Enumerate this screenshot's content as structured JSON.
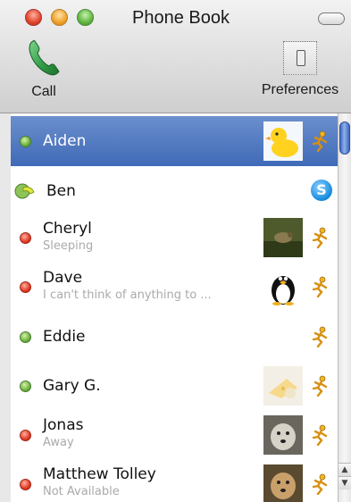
{
  "window": {
    "title": "Phone Book"
  },
  "toolbar": {
    "call_label": "Call",
    "preferences_label": "Preferences"
  },
  "contacts": [
    {
      "name": "Aiden",
      "status": "",
      "presence": "available",
      "service": "aim",
      "avatar": "rubber-duck",
      "selected": true
    },
    {
      "name": "Ben",
      "status": "",
      "presence": "available",
      "service": "skype",
      "avatar": "",
      "selected": false
    },
    {
      "name": "Cheryl",
      "status": "Sleeping",
      "presence": "away",
      "service": "aim",
      "avatar": "bird-photo",
      "selected": false
    },
    {
      "name": "Dave",
      "status": "I can't think of anything to ...",
      "presence": "away",
      "service": "aim",
      "avatar": "penguin",
      "selected": false
    },
    {
      "name": "Eddie",
      "status": "",
      "presence": "available",
      "service": "aim",
      "avatar": "",
      "selected": false
    },
    {
      "name": "Gary G.",
      "status": "",
      "presence": "available",
      "service": "aim",
      "avatar": "cheese",
      "selected": false
    },
    {
      "name": "Jonas",
      "status": "Away",
      "presence": "away",
      "service": "aim",
      "avatar": "dog-gray",
      "selected": false
    },
    {
      "name": "Matthew Tolley",
      "status": "Not Available",
      "presence": "away",
      "service": "aim",
      "avatar": "dog-golden",
      "selected": false
    }
  ],
  "colors": {
    "selection": "#4a74bd",
    "available": "#6fb33f",
    "away": "#e23a25",
    "aim_running_man": "#e8a21e",
    "skype": "#1a8fe0"
  }
}
